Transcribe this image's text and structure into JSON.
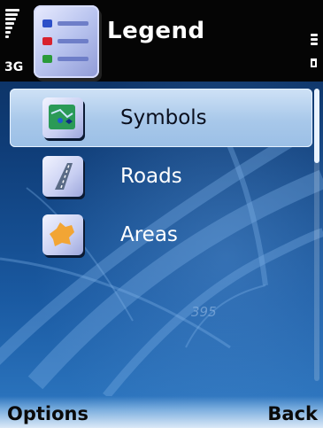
{
  "header": {
    "title": "Legend",
    "network": "3G"
  },
  "list": {
    "items": [
      {
        "label": "Symbols",
        "icon": "symbols-map-icon",
        "selected": true
      },
      {
        "label": "Roads",
        "icon": "road-icon",
        "selected": false
      },
      {
        "label": "Areas",
        "icon": "area-icon",
        "selected": false
      }
    ]
  },
  "background": {
    "map_label": "395"
  },
  "softkeys": {
    "left": "Options",
    "right": "Back"
  },
  "colors": {
    "accent": "#9bbfe6",
    "background": "#1a5aa2"
  }
}
